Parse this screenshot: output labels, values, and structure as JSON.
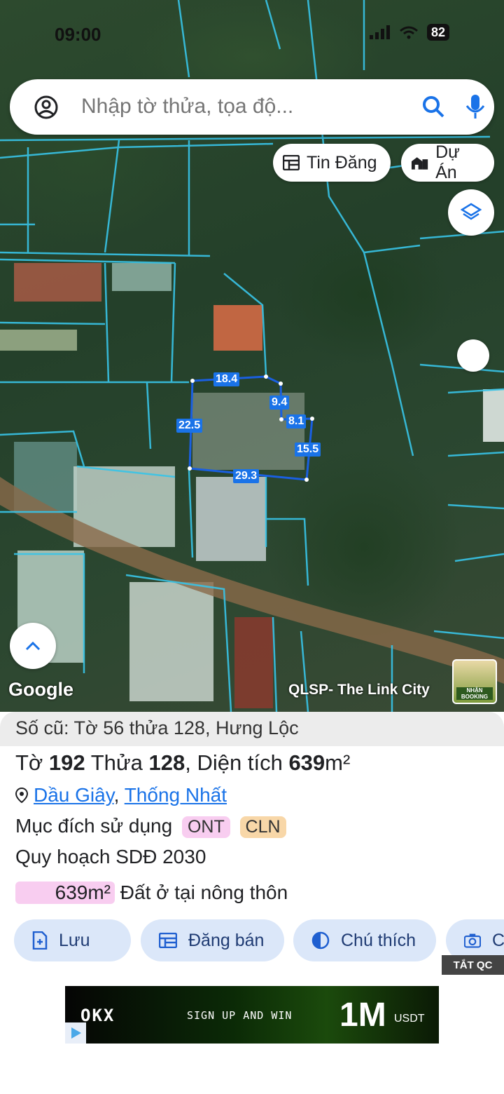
{
  "status_bar": {
    "time": "09:00",
    "battery": "82"
  },
  "search": {
    "placeholder": "Nhập tờ thửa, tọa độ..."
  },
  "chips": {
    "listings": "Tin Đăng",
    "projects": "Dự Án"
  },
  "map": {
    "dimensions": {
      "top": "18.4",
      "right_upper": "9.4",
      "notch": "8.1",
      "right": "15.5",
      "bottom": "29.3",
      "left": "22.5"
    },
    "google_logo": "Google",
    "overlay_label": "QLSP- The Link City",
    "thumb_label": "NHẬN BOOKING"
  },
  "parcel": {
    "old_info": "Số cũ: Tờ 56 thửa 128, Hưng Lộc",
    "to_label": "Tờ",
    "to_value": "192",
    "thua_label": "Thửa",
    "thua_value": "128",
    "area_label": "Diện tích",
    "area_value": "639",
    "area_unit": "m²",
    "location_district": "Dầu Giây",
    "location_separator": ",",
    "location_commune": "Thống Nhất",
    "usage_label": "Mục đích sử dụng",
    "usage_tags": [
      "ONT",
      "CLN"
    ],
    "planning_label": "Quy hoạch SDĐ 2030",
    "planning_area": "639m²",
    "planning_desc": "Đất ở tại nông thôn"
  },
  "actions": {
    "save": "Lưu",
    "sell": "Đăng bán",
    "legend": "Chú thích",
    "capture": "C"
  },
  "ads": {
    "hide_label": "TẮT QC",
    "brand": "OKX",
    "slogan": "SIGN UP AND WIN",
    "amount": "1M",
    "currency": "USDT"
  },
  "colors": {
    "accent": "#1a73e8",
    "ont": "#f8cdf0",
    "cln": "#f8d7a8",
    "button_bg": "#dbe7f9"
  }
}
